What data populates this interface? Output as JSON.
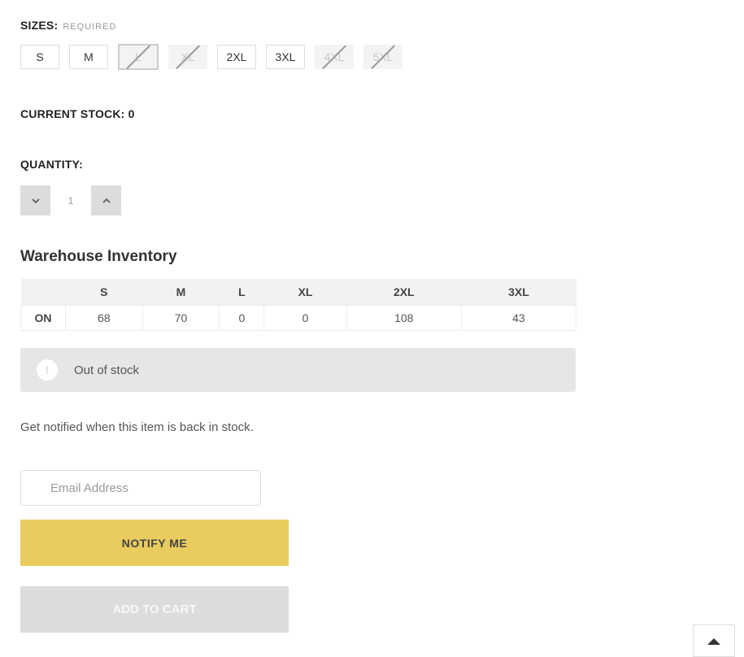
{
  "sizes": {
    "label": "SIZES:",
    "required_label": "REQUIRED",
    "options": [
      {
        "label": "S",
        "available": true,
        "selected": false
      },
      {
        "label": "M",
        "available": true,
        "selected": false
      },
      {
        "label": "L",
        "available": false,
        "selected": true
      },
      {
        "label": "XL",
        "available": false,
        "selected": false
      },
      {
        "label": "2XL",
        "available": true,
        "selected": false
      },
      {
        "label": "3XL",
        "available": true,
        "selected": false
      },
      {
        "label": "4XL",
        "available": false,
        "selected": false
      },
      {
        "label": "5XL",
        "available": false,
        "selected": false
      }
    ]
  },
  "stock": {
    "label": "CURRENT STOCK: 0"
  },
  "quantity": {
    "label": "QUANTITY:",
    "value": "1",
    "decrease_icon": "chevron-down-icon",
    "increase_icon": "chevron-up-icon"
  },
  "inventory": {
    "title": "Warehouse Inventory",
    "columns": [
      "",
      "S",
      "M",
      "L",
      "XL",
      "2XL",
      "3XL"
    ],
    "rows": [
      {
        "warehouse": "ON",
        "values": [
          "68",
          "70",
          "0",
          "0",
          "108",
          "43"
        ]
      }
    ]
  },
  "alert": {
    "icon": "exclamation-circle-icon",
    "glyph": "!",
    "text": "Out of stock"
  },
  "notify": {
    "text": "Get notified when this item is back in stock.",
    "email_placeholder": "Email Address",
    "email_value": "",
    "button_label": "NOTIFY ME"
  },
  "cart": {
    "button_label": "ADD TO CART"
  },
  "colors": {
    "notify_button": "#e9cb5e",
    "disabled_button": "#dcdcdc",
    "alert_bg": "#e6e6e6"
  }
}
